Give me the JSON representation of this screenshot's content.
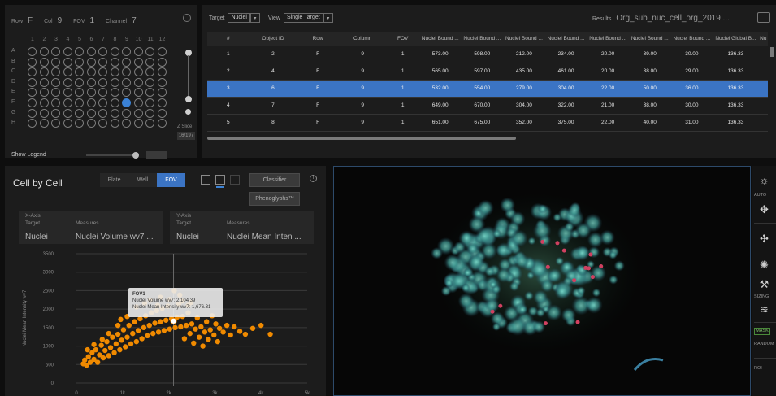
{
  "plate": {
    "row_label": "Row",
    "row_value": "F",
    "col_label": "Col",
    "col_value": "9",
    "fov_label": "FOV",
    "fov_value": "1",
    "channel_label": "Channel",
    "channel_value": "7",
    "columns": [
      "1",
      "2",
      "3",
      "4",
      "5",
      "6",
      "7",
      "8",
      "9",
      "10",
      "11",
      "12"
    ],
    "rows": [
      "A",
      "B",
      "C",
      "D",
      "E",
      "F",
      "G",
      "H"
    ],
    "selected_well": "F9",
    "zslice_label": "Z Slice",
    "zslice_value": "16/197",
    "show_legend_label": "Show Legend"
  },
  "results_table": {
    "target_label": "Target",
    "target_value": "Nuclei",
    "view_label": "View",
    "view_value": "Single Target",
    "results_label": "Results",
    "results_name": "Org_sub_nuc_cell_org_2019 ...",
    "columns": [
      "#",
      "Object ID",
      "Row",
      "Column",
      "FOV",
      "Nuclei Bound ...",
      "Nuclei Bound ...",
      "Nuclei Bound ...",
      "Nuclei Bound ...",
      "Nuclei Bound ...",
      "Nuclei Bound ...",
      "Nuclei Bound ...",
      "Nuclei Global B...",
      "Nu"
    ],
    "rows": [
      [
        "1",
        "2",
        "F",
        "9",
        "1",
        "573.00",
        "598.00",
        "212.00",
        "234.00",
        "20.00",
        "39.00",
        "30.00",
        "136.33",
        ""
      ],
      [
        "2",
        "4",
        "F",
        "9",
        "1",
        "565.00",
        "597.00",
        "435.00",
        "461.00",
        "20.00",
        "38.00",
        "29.00",
        "136.33",
        ""
      ],
      [
        "3",
        "6",
        "F",
        "9",
        "1",
        "532.00",
        "554.00",
        "279.00",
        "304.00",
        "22.00",
        "50.00",
        "36.00",
        "136.33",
        ""
      ],
      [
        "4",
        "7",
        "F",
        "9",
        "1",
        "649.00",
        "670.00",
        "304.00",
        "322.00",
        "21.00",
        "38.00",
        "30.00",
        "136.33",
        ""
      ],
      [
        "5",
        "8",
        "F",
        "9",
        "1",
        "651.00",
        "675.00",
        "352.00",
        "375.00",
        "22.00",
        "40.00",
        "31.00",
        "136.33",
        ""
      ]
    ],
    "selected_row": 2
  },
  "cell_by_cell": {
    "title": "Cell by Cell",
    "tabs": [
      "Plate",
      "Well",
      "FOV"
    ],
    "active_tab": "FOV",
    "classifier_label": "Classifier",
    "phenoglyphs_label": "Phenoglyphs™",
    "x_axis": {
      "header": "X-Axis",
      "target_label": "Target",
      "measures_label": "Measures",
      "target": "Nuclei",
      "measure": "Nuclei Volume wv7 ..."
    },
    "y_axis": {
      "header": "Y-Axis",
      "target_label": "Target",
      "measures_label": "Measures",
      "target": "Nuclei",
      "measure": "Nuclei Mean Inten ..."
    },
    "tooltip": {
      "title": "FOV1",
      "line1": "Nuclei Volume wv7: 2,104.39",
      "line2": "Nuclei Mean Intensity wv7: 1,676.31"
    }
  },
  "chart_data": {
    "type": "scatter",
    "xlabel": "",
    "ylabel": "Nuclei Mean Intensity wv7",
    "x_ticks": [
      "0",
      "1k",
      "2k",
      "3k",
      "4k",
      "5k"
    ],
    "y_ticks": [
      "0",
      "500",
      "1000",
      "1500",
      "2000",
      "2500",
      "3000",
      "3500"
    ],
    "xlim": [
      0,
      5000
    ],
    "ylim": [
      0,
      3500
    ],
    "color": "#f08a00",
    "highlight": {
      "x": 2104.39,
      "y": 1676.31
    },
    "points": [
      [
        150,
        520
      ],
      [
        180,
        620
      ],
      [
        220,
        480
      ],
      [
        260,
        710
      ],
      [
        300,
        560
      ],
      [
        340,
        820
      ],
      [
        380,
        640
      ],
      [
        420,
        900
      ],
      [
        460,
        560
      ],
      [
        500,
        760
      ],
      [
        540,
        1020
      ],
      [
        580,
        680
      ],
      [
        620,
        880
      ],
      [
        660,
        1120
      ],
      [
        700,
        740
      ],
      [
        740,
        960
      ],
      [
        780,
        1240
      ],
      [
        820,
        820
      ],
      [
        860,
        1060
      ],
      [
        900,
        1320
      ],
      [
        940,
        900
      ],
      [
        980,
        1160
      ],
      [
        1020,
        1440
      ],
      [
        1060,
        980
      ],
      [
        1100,
        1240
      ],
      [
        1140,
        1560
      ],
      [
        1180,
        1060
      ],
      [
        1220,
        1340
      ],
      [
        1260,
        1660
      ],
      [
        1300,
        1120
      ],
      [
        1340,
        1420
      ],
      [
        1380,
        1740
      ],
      [
        1420,
        1200
      ],
      [
        1460,
        1500
      ],
      [
        1500,
        1820
      ],
      [
        1540,
        1280
      ],
      [
        1580,
        1560
      ],
      [
        1620,
        1900
      ],
      [
        1660,
        1340
      ],
      [
        1700,
        1620
      ],
      [
        1740,
        1960
      ],
      [
        1780,
        1380
      ],
      [
        1820,
        1660
      ],
      [
        1860,
        2020
      ],
      [
        1900,
        1420
      ],
      [
        1940,
        1700
      ],
      [
        1980,
        2080
      ],
      [
        2020,
        1460
      ],
      [
        2060,
        1740
      ],
      [
        2104,
        1676
      ],
      [
        2140,
        1500
      ],
      [
        2180,
        1780
      ],
      [
        2220,
        2140
      ],
      [
        2260,
        1520
      ],
      [
        2300,
        1800
      ],
      [
        2340,
        1200
      ],
      [
        2380,
        1560
      ],
      [
        2420,
        1900
      ],
      [
        2460,
        1340
      ],
      [
        2500,
        1600
      ],
      [
        2540,
        1080
      ],
      [
        2580,
        1460
      ],
      [
        2620,
        1760
      ],
      [
        2660,
        1240
      ],
      [
        2700,
        1520
      ],
      [
        2740,
        1000
      ],
      [
        2780,
        1380
      ],
      [
        2820,
        1660
      ],
      [
        2860,
        1180
      ],
      [
        2900,
        1440
      ],
      [
        2940,
        1820
      ],
      [
        2980,
        1300
      ],
      [
        3020,
        1600
      ],
      [
        3060,
        1120
      ],
      [
        3100,
        1480
      ],
      [
        3180,
        1380
      ],
      [
        3260,
        1560
      ],
      [
        3340,
        1300
      ],
      [
        3420,
        1520
      ],
      [
        3540,
        1400
      ],
      [
        3660,
        1320
      ],
      [
        3820,
        1480
      ],
      [
        4000,
        1560
      ],
      [
        4200,
        1320
      ],
      [
        1600,
        2240
      ],
      [
        1820,
        2320
      ],
      [
        2020,
        2260
      ],
      [
        2240,
        2380
      ],
      [
        2120,
        2500
      ],
      [
        1760,
        2100
      ],
      [
        2300,
        2220
      ],
      [
        2480,
        2180
      ],
      [
        700,
        1340
      ],
      [
        560,
        1180
      ],
      [
        900,
        1560
      ],
      [
        1100,
        1800
      ],
      [
        1300,
        2060
      ],
      [
        240,
        900
      ],
      [
        380,
        1040
      ],
      [
        1480,
        2160
      ],
      [
        960,
        1720
      ],
      [
        2420,
        2100
      ]
    ]
  },
  "image_view": {
    "tools": [
      "brightness-icon",
      "pan-icon",
      "move-cross-icon",
      "object-icon",
      "sizing-icon",
      "layers-icon"
    ],
    "auto_label": "AUTO",
    "sizing_label": "SIZING",
    "mask_label": "MASK",
    "random_label": "RANDOM",
    "roi_label": "ROI"
  }
}
